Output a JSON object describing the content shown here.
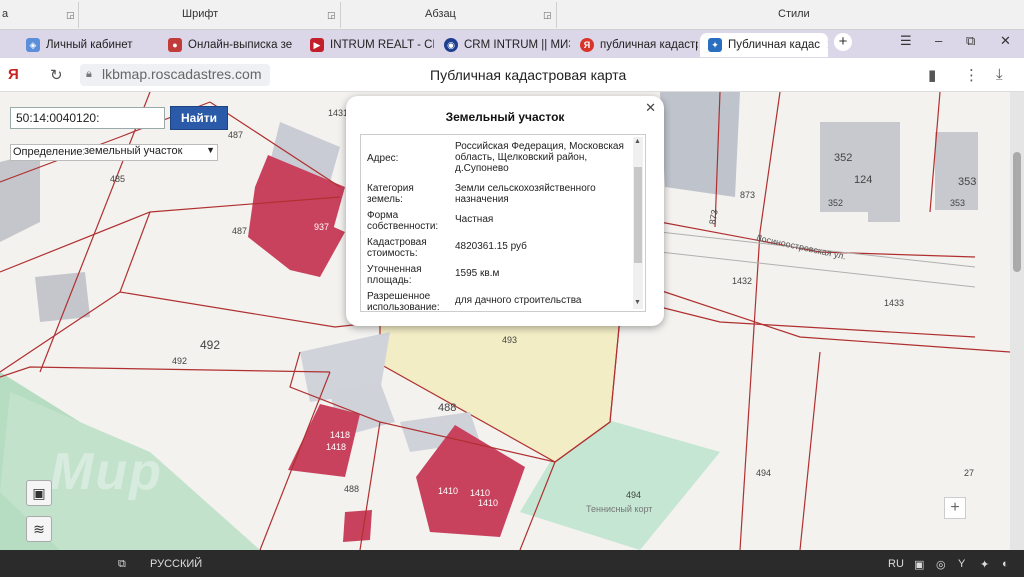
{
  "ribbon": {
    "left_fragment": "а",
    "font": "Шрифт",
    "paragraph": "Абзац",
    "styles": "Стили"
  },
  "tabs": [
    {
      "label": "Личный кабинет",
      "color": "#5b8fd9"
    },
    {
      "label": "Онлайн-выписка зе",
      "color": "#c23b3b"
    },
    {
      "label": "INTRUM REALT - CR",
      "color": "#c21f2a"
    },
    {
      "label": "CRM INTRUM || МИЭ",
      "color": "#1e3f8f"
    },
    {
      "label": "публичная кадастр",
      "color": "#d8342a"
    },
    {
      "label": "Публичная кадас",
      "color": "#2a6fbf",
      "active": true
    }
  ],
  "browser": {
    "url": "lkbmap.roscadastres.com",
    "title": "Публичная кадастровая карта"
  },
  "search": {
    "value": "50:14:0040120:",
    "button": "Найти",
    "def_label": "Определение:",
    "def_value": "земельный участок"
  },
  "popup": {
    "title": "Земельный участок",
    "rows": [
      {
        "key": "Адрес:",
        "value": "Российская Федерация, Московская область, Щелковский район, д.Супонево"
      },
      {
        "key": "Категория земель:",
        "value": "Земли сельскохозяйственного назначения"
      },
      {
        "key": "Форма собственности:",
        "value": "Частная"
      },
      {
        "key": "Кадастровая стоимость:",
        "value": "4820361.15 руб"
      },
      {
        "key": "Уточненная площадь:",
        "value": "1595 кв.м"
      },
      {
        "key": "Разрешенное использование:",
        "value": "для дачного строительства"
      }
    ]
  },
  "map_labels": {
    "l1431": "1431",
    "l487a": "487",
    "l485": "485",
    "l487b": "487",
    "l937": "937",
    "l492a": "492",
    "l492b": "492",
    "l493": "493",
    "l488a": "488",
    "l488b": "488",
    "l1418a": "1418",
    "l1418b": "1418",
    "l1410a": "1410",
    "l1410b": "1410",
    "l1410c": "1410",
    "l873a": "873",
    "l873b": "873",
    "l352a": "352",
    "l352b": "352",
    "l124": "124",
    "l353a": "353",
    "l353b": "353",
    "l1432": "1432",
    "l1433": "1433",
    "l494a": "494",
    "l494b": "494",
    "l27": "27",
    "street": "Лосиноостровская ул.",
    "tennis": "Теннисный корт"
  },
  "watermark": "Мир",
  "taskbar": {
    "lang_status": "РУССКИЙ",
    "lang": "RU"
  },
  "colors": {
    "building": "#c9425d",
    "boundary": "#b03030",
    "selected": "#f2ecc4",
    "green": "#a9d8b8"
  }
}
